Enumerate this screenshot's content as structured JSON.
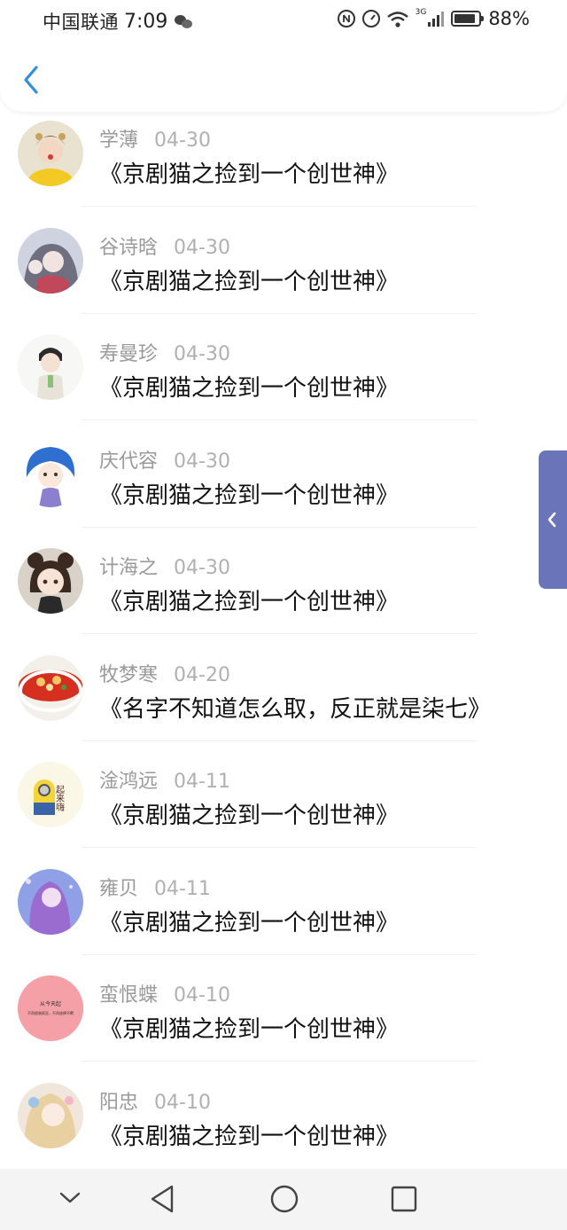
{
  "status_bar": {
    "carrier": "中国联通",
    "time": "7:09",
    "network": "3G",
    "battery": "88%"
  },
  "header": {
    "back_icon": "chevron-left-icon"
  },
  "comments": [
    {
      "name": "学薄",
      "date": "04-30",
      "title": "《京剧猫之捡到一个创世神》"
    },
    {
      "name": "谷诗晗",
      "date": "04-30",
      "title": "《京剧猫之捡到一个创世神》"
    },
    {
      "name": "寿曼珍",
      "date": "04-30",
      "title": "《京剧猫之捡到一个创世神》"
    },
    {
      "name": "庆代容",
      "date": "04-30",
      "title": "《京剧猫之捡到一个创世神》"
    },
    {
      "name": "计海之",
      "date": "04-30",
      "title": "《京剧猫之捡到一个创世神》"
    },
    {
      "name": "牧梦寒",
      "date": "04-20",
      "title": "《名字不知道怎么取，反正就是柒七》"
    },
    {
      "name": "淦鸿远",
      "date": "04-11",
      "title": "《京剧猫之捡到一个创世神》"
    },
    {
      "name": "雍贝",
      "date": "04-11",
      "title": "《京剧猫之捡到一个创世神》"
    },
    {
      "name": "蛮恨蝶",
      "date": "04-10",
      "title": "《京剧猫之捡到一个创世神》"
    },
    {
      "name": "阳忠",
      "date": "04-10",
      "title": "《京剧猫之捡到一个创世神》"
    }
  ],
  "avatar_texts": {
    "minion": "起来嗨",
    "pink_line1": "从今天起",
    "pink_line2": "不再假装疯狂，不再放肆不羁"
  },
  "colors": {
    "accent": "#2f8fe0",
    "side_tab": "#6a74b8",
    "name_gray": "#9a9a9a",
    "nav_bg": "#f4f4f4"
  }
}
